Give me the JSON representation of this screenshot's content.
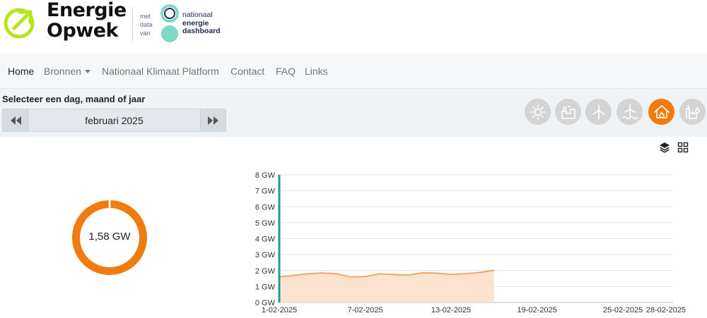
{
  "header": {
    "brand_line1": "Energie",
    "brand_line2": "Opwek",
    "met_line1": "met",
    "met_line2": "data",
    "met_line3": "van",
    "partner_line1": "nationaal",
    "partner_line2": "energie",
    "partner_line3": "dashboard"
  },
  "nav": {
    "items": [
      {
        "label": "Home"
      },
      {
        "label": "Bronnen"
      },
      {
        "label": "Nationaal Klimaat Platform"
      },
      {
        "label": "Contact"
      },
      {
        "label": "FAQ"
      },
      {
        "label": "Links"
      }
    ]
  },
  "selector": {
    "label": "Selecteer een dag, maand of jaar",
    "period": "februari 2025"
  },
  "sources": [
    {
      "icon": "sun-icon",
      "active": false
    },
    {
      "icon": "factory-icon",
      "active": false
    },
    {
      "icon": "wind-turbine-icon",
      "active": false
    },
    {
      "icon": "offshore-wind-icon",
      "active": false
    },
    {
      "icon": "house-heat-icon",
      "active": true
    },
    {
      "icon": "power-plant-icon",
      "active": false
    }
  ],
  "colors": {
    "accent": "#f07c10",
    "line": "#f2a566",
    "fill": "#fde3cf",
    "cursor": "#1f9b8f",
    "logo_green": "#b5e61d",
    "partner_teal": "#7fd9c4"
  },
  "donut": {
    "value_label": "1,58 GW"
  },
  "chart_data": {
    "type": "area",
    "y_ticks": [
      "0 GW",
      "1 GW",
      "2 GW",
      "3 GW",
      "4 GW",
      "5 GW",
      "6 GW",
      "7 GW",
      "8 GW"
    ],
    "ylim": [
      0,
      8
    ],
    "x_ticks": [
      {
        "day": 1,
        "label": "1-02-2025"
      },
      {
        "day": 7,
        "label": "7-02-2025"
      },
      {
        "day": 13,
        "label": "13-02-2025"
      },
      {
        "day": 19,
        "label": "19-02-2025"
      },
      {
        "day": 25,
        "label": "25-02-2025"
      },
      {
        "day": 28,
        "label": "28-02-2025"
      }
    ],
    "xlim": [
      1,
      28.5
    ],
    "x": [
      1,
      2,
      3,
      4,
      5,
      6,
      7,
      8,
      9,
      10,
      11,
      12,
      13,
      14,
      15,
      16
    ],
    "values": [
      1.6,
      1.7,
      1.8,
      1.85,
      1.8,
      1.6,
      1.62,
      1.8,
      1.75,
      1.72,
      1.86,
      1.84,
      1.76,
      1.8,
      1.88,
      2.02
    ],
    "cursor_day": 1,
    "grid": true
  }
}
